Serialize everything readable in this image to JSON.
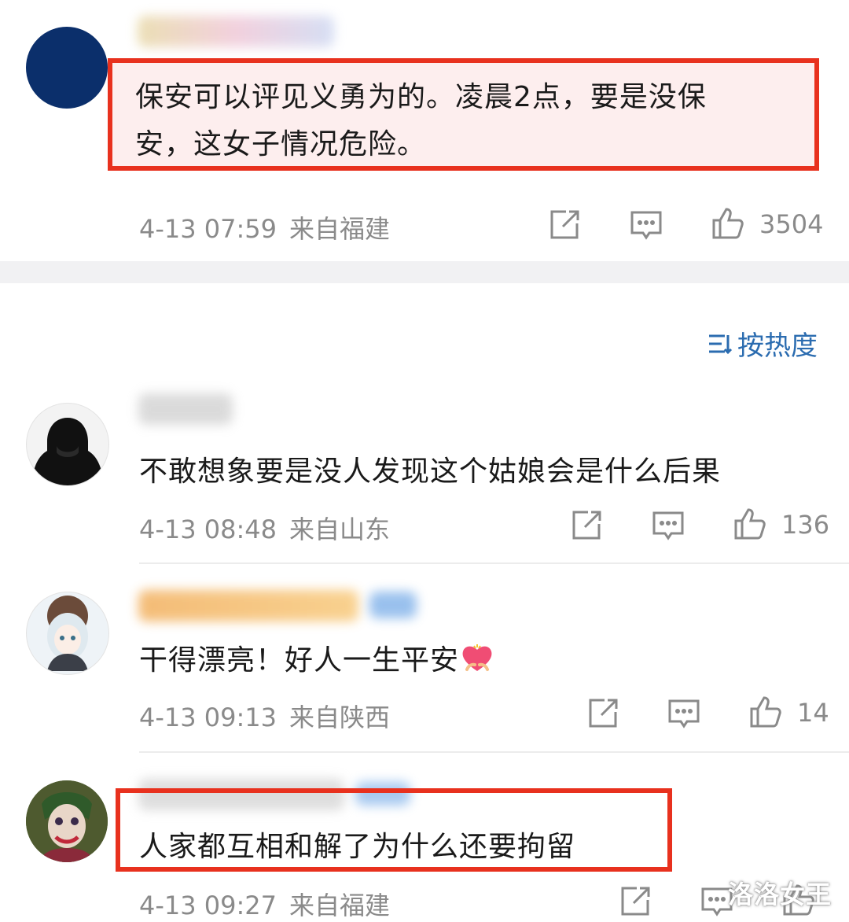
{
  "sort_label": "按热度",
  "comments": [
    {
      "text_lines": [
        "保安可以评见义勇为的。凌晨2点，要是没保",
        "安，这女子情况危险。"
      ],
      "time": "4-13 07:59",
      "location": "来自福建",
      "likes": "3504"
    },
    {
      "text": "不敢想象要是没人发现这个姑娘会是什么后果",
      "time": "4-13 08:48",
      "location": "来自山东",
      "likes": "136"
    },
    {
      "text": "干得漂亮！好人一生平安",
      "time": "4-13 09:13",
      "location": "来自陕西",
      "likes": "14"
    },
    {
      "text": "人家都互相和解了为什么还要拘留",
      "time": "4-13 09:27",
      "location": "来自福建",
      "likes": ""
    }
  ],
  "watermark": "洛洛女王",
  "colors": {
    "highlight_box": "#e8311e",
    "accent_blue": "#2b6cb0",
    "meta_gray": "#8a8a8a"
  },
  "icons": [
    "share-icon",
    "comment-icon",
    "like-icon",
    "sort-icon",
    "heart-emoji-icon"
  ]
}
